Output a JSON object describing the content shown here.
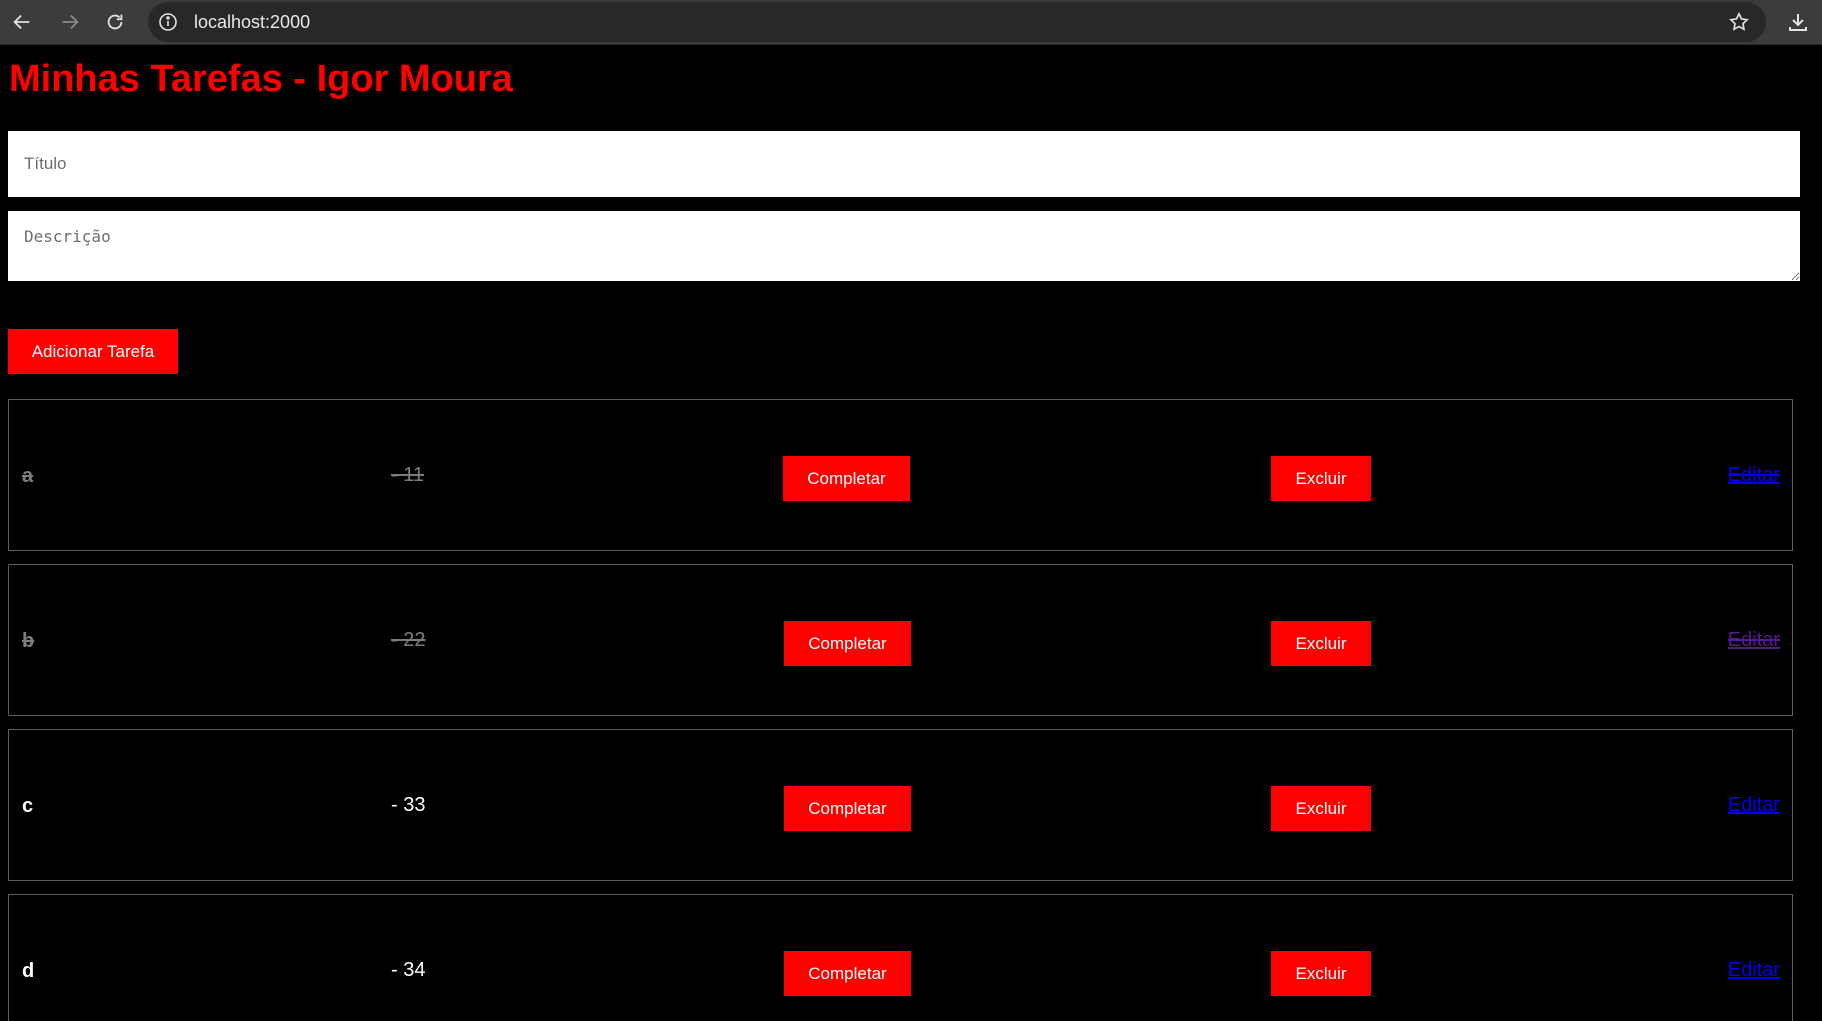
{
  "browser": {
    "url": "localhost:2000"
  },
  "page": {
    "title": "Minhas Tarefas - Igor Moura",
    "title_placeholder": "Título",
    "description_placeholder": "Descrição",
    "add_button_label": "Adicionar Tarefa"
  },
  "tasks": [
    {
      "title": "a",
      "description": "- 11",
      "completed": true,
      "complete_label": "Completar",
      "delete_label": "Excluir",
      "edit_label": "Editar"
    },
    {
      "title": "b",
      "description": "- 22",
      "completed": true,
      "complete_label": "Completar",
      "delete_label": "Excluir",
      "edit_label": "Editar"
    },
    {
      "title": "c",
      "description": "- 33",
      "completed": false,
      "complete_label": "Completar",
      "delete_label": "Excluir",
      "edit_label": "Editar"
    },
    {
      "title": "d",
      "description": "- 34",
      "completed": false,
      "complete_label": "Completar",
      "delete_label": "Excluir",
      "edit_label": "Editar"
    }
  ],
  "colors": {
    "accent": "#ff0000",
    "background": "#000000",
    "link": "#0000ee",
    "visited_link": "#551a8b",
    "completed_text": "#7d7d7d"
  },
  "icons": {
    "back": "arrow-left-icon",
    "forward": "arrow-right-icon",
    "reload": "reload-icon",
    "site_info": "info-icon",
    "bookmark": "star-icon",
    "download": "download-icon"
  }
}
